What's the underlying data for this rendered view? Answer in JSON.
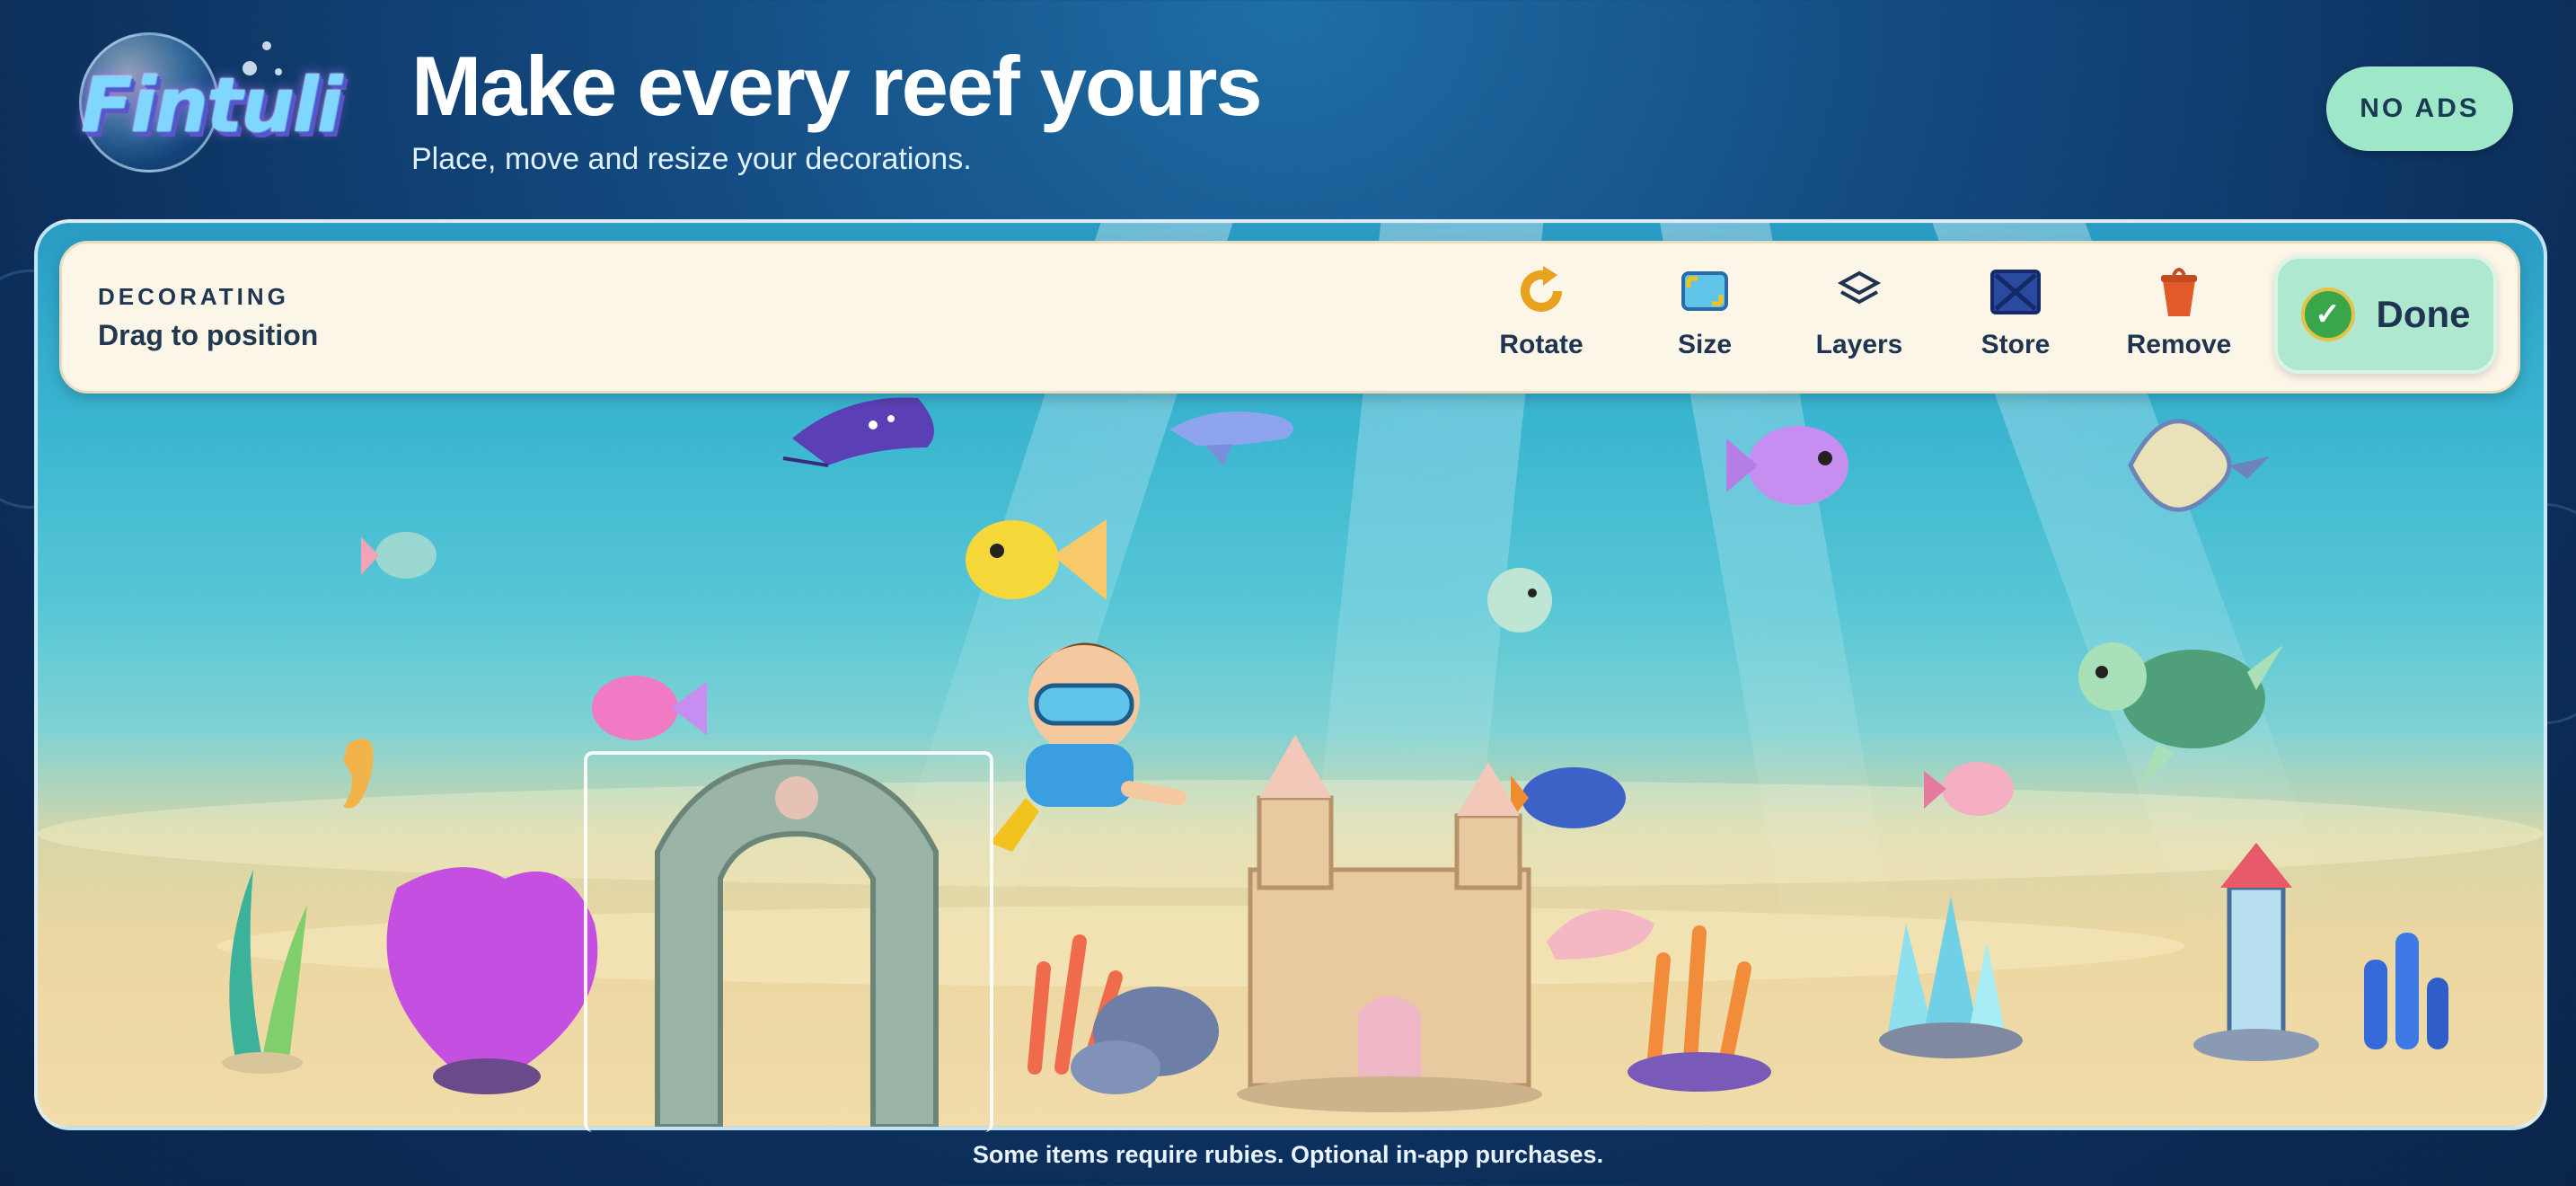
{
  "app": {
    "logo_text": "Fintuli"
  },
  "header": {
    "title": "Make every reef yours",
    "subtitle": "Place, move and resize your decorations.",
    "no_ads_label": "NO ADS"
  },
  "toolbar": {
    "mode_label": "DECORATING",
    "mode_hint": "Drag to position",
    "tools": [
      {
        "label": "Rotate",
        "icon": "rotate-icon"
      },
      {
        "label": "Size",
        "icon": "resize-icon"
      },
      {
        "label": "Layers",
        "icon": "layers-icon"
      },
      {
        "label": "Store",
        "icon": "crate-icon"
      },
      {
        "label": "Remove",
        "icon": "trash-bucket-icon"
      }
    ],
    "done_label": "Done"
  },
  "scene": {
    "creatures": [
      "manta-ray",
      "dolphin",
      "yellow-fish",
      "purple-fish",
      "angelfish",
      "small-teal-fish",
      "pufferfish",
      "pink-fish",
      "seahorse",
      "diver-boy",
      "mandarin-fish",
      "pink-small-fish",
      "sea-turtle"
    ],
    "decorations": [
      "seaweed",
      "purple-fan-coral",
      "stone-arch",
      "red-coral",
      "rocks",
      "sandcastle",
      "clam-shell",
      "coral-cluster",
      "crystals",
      "lighthouse",
      "blue-tube-sponge"
    ],
    "selected": "stone-arch"
  },
  "footer": {
    "note": "Some items require rubies. Optional in-app purchases."
  },
  "colors": {
    "accent_mint": "#9ee7c9",
    "done_bg": "#aee9cf",
    "toolbar_bg": "#fbf6e8",
    "text_dark": "#1e3450"
  }
}
